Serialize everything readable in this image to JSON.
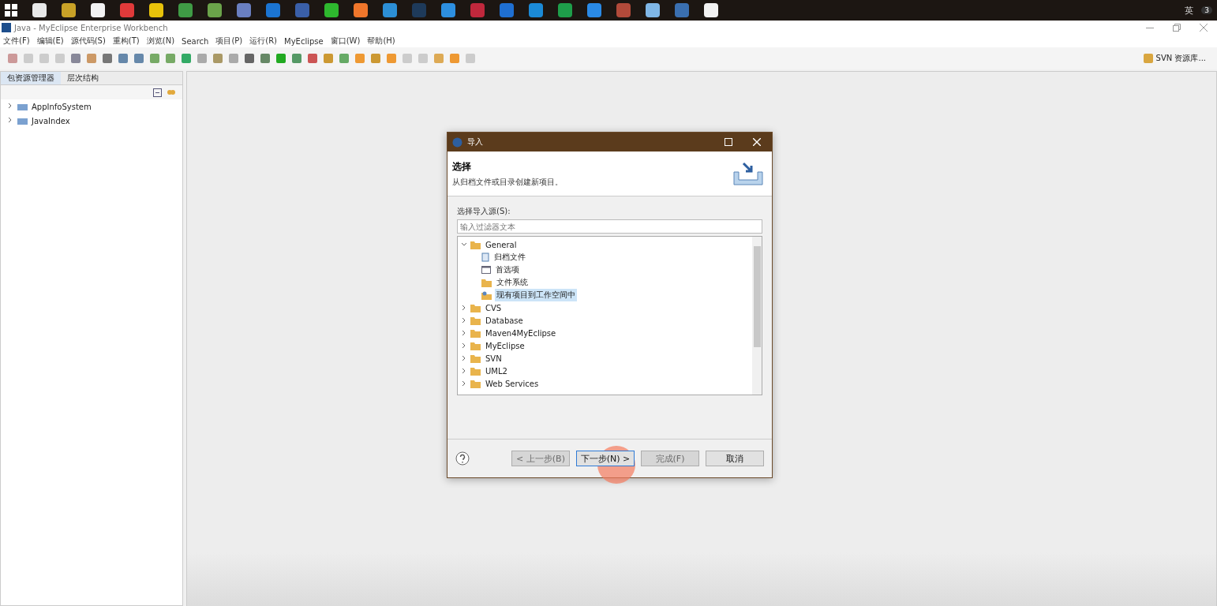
{
  "taskbar": {
    "apps": [
      {
        "color": "#e8e8e8"
      },
      {
        "color": "#c9a227"
      },
      {
        "color": "#f2f2f2"
      },
      {
        "color": "#e03a3a"
      },
      {
        "color": "#e8c20a"
      },
      {
        "color": "#3f9b45"
      },
      {
        "color": "#6ba34a"
      },
      {
        "color": "#6a7fc0"
      },
      {
        "color": "#1b74d1"
      },
      {
        "color": "#3a5fa8"
      },
      {
        "color": "#2eb82e"
      },
      {
        "color": "#f0762b"
      },
      {
        "color": "#2c8fd6"
      },
      {
        "color": "#1e3a5a"
      },
      {
        "color": "#2d8fe0"
      },
      {
        "color": "#c0283c"
      },
      {
        "color": "#1f6fd1"
      },
      {
        "color": "#1b8ad6"
      },
      {
        "color": "#1e9e4a"
      },
      {
        "color": "#2a8ae6"
      },
      {
        "color": "#b24a3a"
      },
      {
        "color": "#7fb6e6"
      },
      {
        "color": "#3a6fb0"
      },
      {
        "color": "#f2f2f2"
      }
    ],
    "ime": "英",
    "notifications": "3"
  },
  "window": {
    "title": "Java  -  MyEclipse Enterprise Workbench"
  },
  "menu": [
    "文件(F)",
    "编辑(E)",
    "源代码(S)",
    "重构(T)",
    "浏览(N)",
    "Search",
    "项目(P)",
    "运行(R)",
    "MyEclipse",
    "窗口(W)",
    "帮助(H)"
  ],
  "perspective": {
    "label": "SVN 资源库..."
  },
  "left_panel": {
    "tabs": [
      {
        "label": "包资源管理器",
        "selected": true
      },
      {
        "label": "层次结构",
        "selected": false
      }
    ],
    "projects": [
      {
        "name": "AppInfoSystem"
      },
      {
        "name": "JavaIndex"
      }
    ]
  },
  "dialog": {
    "title": "导入",
    "heading": "选择",
    "description": "从归档文件或目录创建新项目。",
    "source_label": "选择导入源(S):",
    "filter": {
      "placeholder": "输入过滤器文本"
    },
    "tree": [
      {
        "label": "General",
        "expanded": true,
        "children": [
          {
            "label": "归档文件",
            "kind": "file",
            "selected": false
          },
          {
            "label": "首选项",
            "kind": "prefs",
            "selected": false
          },
          {
            "label": "文件系统",
            "kind": "folder",
            "selected": false
          },
          {
            "label": "现有项目到工作空间中",
            "kind": "project",
            "selected": true
          }
        ]
      },
      {
        "label": "CVS",
        "expanded": false
      },
      {
        "label": "Database",
        "expanded": false
      },
      {
        "label": "Maven4MyEclipse",
        "expanded": false
      },
      {
        "label": "MyEclipse",
        "expanded": false
      },
      {
        "label": "SVN",
        "expanded": false
      },
      {
        "label": "UML2",
        "expanded": false
      },
      {
        "label": "Web Services",
        "expanded": false
      }
    ],
    "buttons": [
      {
        "label": "< 上一步(B)",
        "disabled": true,
        "focused": false
      },
      {
        "label": "下一步(N) >",
        "disabled": false,
        "focused": true
      },
      {
        "label": "完成(F)",
        "disabled": true,
        "focused": false
      },
      {
        "label": "取消",
        "disabled": false,
        "focused": false
      }
    ]
  }
}
